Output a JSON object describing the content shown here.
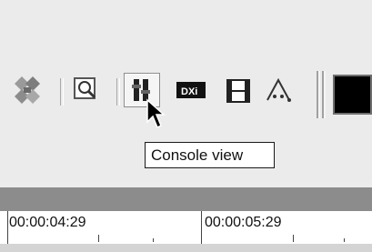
{
  "toolbar": {
    "items": [
      {
        "name": "effects-icon"
      },
      {
        "name": "zoom-icon"
      },
      {
        "name": "console-view-icon",
        "pressed": true
      },
      {
        "name": "dxi-icon"
      },
      {
        "name": "film-icon"
      },
      {
        "name": "triangle-envelope-icon"
      }
    ],
    "color_swatch": "#000000"
  },
  "tooltip": {
    "text": "Console view"
  },
  "timeline": {
    "labels": [
      "00:00:04:29",
      "00:00:05:29"
    ]
  },
  "colors": {
    "background": "#ebebeb",
    "track_bar": "#8c8c8c",
    "tooltip_bg": "#ffffff"
  }
}
